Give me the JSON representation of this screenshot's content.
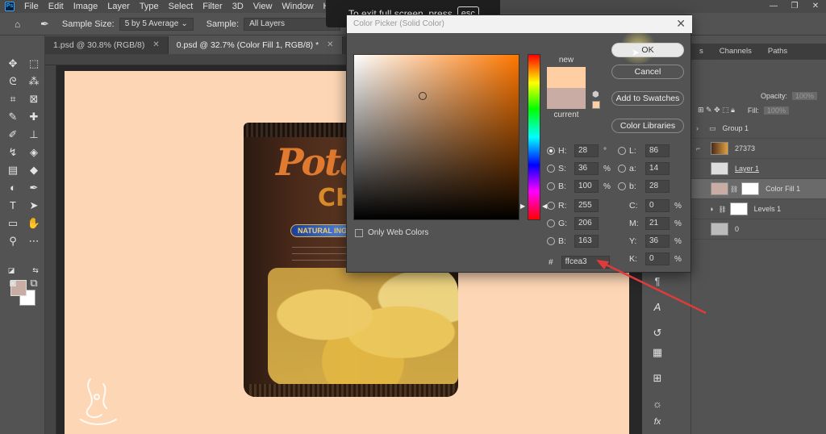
{
  "menubar": {
    "logo": "Ps",
    "items": [
      "File",
      "Edit",
      "Image",
      "Layer",
      "Type",
      "Select",
      "Filter",
      "3D",
      "View",
      "Window",
      "Help"
    ]
  },
  "options": {
    "sample_size_label": "Sample Size:",
    "sample_size_value": "5 by 5 Average",
    "sample_label": "Sample:",
    "sample_value": "All Layers"
  },
  "tabs": [
    {
      "label": "1.psd @ 30.8% (RGB/8)"
    },
    {
      "label": "0.psd @ 32.7% (Color Fill 1, RGB/8) *"
    }
  ],
  "fullscreen_notice": {
    "text": "To exit full screen, press",
    "key": "esc"
  },
  "bag": {
    "title": "Pota",
    "subtitle": "CH",
    "pill": "NATURAL INGRE"
  },
  "colors": {
    "new": "#ffcea3",
    "current": "#c9aca3",
    "canvas_bg": "#fdd7b5",
    "accent_arrow": "#e03a3a"
  },
  "picker": {
    "title": "Color Picker (Solid Color)",
    "new_label": "new",
    "current_label": "current",
    "ok_label": "OK",
    "cancel_label": "Cancel",
    "add_swatches_label": "Add to Swatches",
    "color_libraries_label": "Color Libraries",
    "only_web_label": "Only Web Colors",
    "hsb": [
      {
        "label": "H:",
        "value": "28",
        "unit": "°"
      },
      {
        "label": "S:",
        "value": "36",
        "unit": "%"
      },
      {
        "label": "B:",
        "value": "100",
        "unit": "%"
      }
    ],
    "rgb": [
      {
        "label": "R:",
        "value": "255"
      },
      {
        "label": "G:",
        "value": "206"
      },
      {
        "label": "B:",
        "value": "163"
      }
    ],
    "lab": [
      {
        "label": "L:",
        "value": "86"
      },
      {
        "label": "a:",
        "value": "14"
      },
      {
        "label": "b:",
        "value": "28"
      }
    ],
    "cmyk": [
      {
        "label": "C:",
        "value": "0",
        "unit": "%"
      },
      {
        "label": "M:",
        "value": "21",
        "unit": "%"
      },
      {
        "label": "Y:",
        "value": "36",
        "unit": "%"
      },
      {
        "label": "K:",
        "value": "0",
        "unit": "%"
      }
    ],
    "hex_label": "#",
    "hex_value": "ffcea3"
  },
  "panel": {
    "tabs": [
      "s",
      "Channels",
      "Paths"
    ],
    "opacity_label": "Opacity:",
    "opacity_value": "100%",
    "fill_label": "Fill:",
    "fill_value": "100%",
    "layers": [
      {
        "name": "Group 1"
      },
      {
        "name": "27373"
      },
      {
        "name": "Layer 1"
      },
      {
        "name": "Color Fill 1"
      },
      {
        "name": "Levels 1"
      },
      {
        "name": "0"
      }
    ]
  }
}
